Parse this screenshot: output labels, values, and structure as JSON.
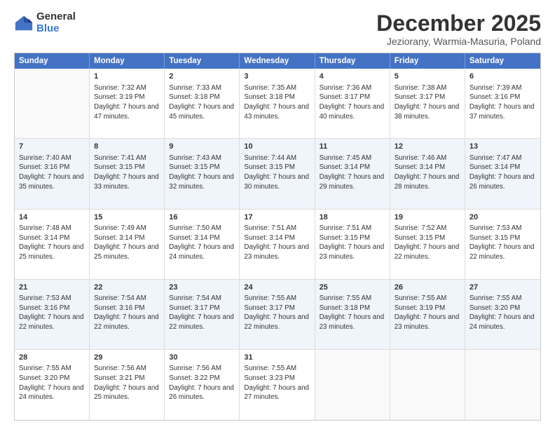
{
  "logo": {
    "general": "General",
    "blue": "Blue"
  },
  "title": "December 2025",
  "subtitle": "Jeziorany, Warmia-Masuria, Poland",
  "weekdays": [
    "Sunday",
    "Monday",
    "Tuesday",
    "Wednesday",
    "Thursday",
    "Friday",
    "Saturday"
  ],
  "rows": [
    [
      {
        "day": "",
        "sunrise": "",
        "sunset": "",
        "daylight": ""
      },
      {
        "day": "1",
        "sunrise": "Sunrise: 7:32 AM",
        "sunset": "Sunset: 3:19 PM",
        "daylight": "Daylight: 7 hours and 47 minutes."
      },
      {
        "day": "2",
        "sunrise": "Sunrise: 7:33 AM",
        "sunset": "Sunset: 3:18 PM",
        "daylight": "Daylight: 7 hours and 45 minutes."
      },
      {
        "day": "3",
        "sunrise": "Sunrise: 7:35 AM",
        "sunset": "Sunset: 3:18 PM",
        "daylight": "Daylight: 7 hours and 43 minutes."
      },
      {
        "day": "4",
        "sunrise": "Sunrise: 7:36 AM",
        "sunset": "Sunset: 3:17 PM",
        "daylight": "Daylight: 7 hours and 40 minutes."
      },
      {
        "day": "5",
        "sunrise": "Sunrise: 7:38 AM",
        "sunset": "Sunset: 3:17 PM",
        "daylight": "Daylight: 7 hours and 38 minutes."
      },
      {
        "day": "6",
        "sunrise": "Sunrise: 7:39 AM",
        "sunset": "Sunset: 3:16 PM",
        "daylight": "Daylight: 7 hours and 37 minutes."
      }
    ],
    [
      {
        "day": "7",
        "sunrise": "Sunrise: 7:40 AM",
        "sunset": "Sunset: 3:16 PM",
        "daylight": "Daylight: 7 hours and 35 minutes."
      },
      {
        "day": "8",
        "sunrise": "Sunrise: 7:41 AM",
        "sunset": "Sunset: 3:15 PM",
        "daylight": "Daylight: 7 hours and 33 minutes."
      },
      {
        "day": "9",
        "sunrise": "Sunrise: 7:43 AM",
        "sunset": "Sunset: 3:15 PM",
        "daylight": "Daylight: 7 hours and 32 minutes."
      },
      {
        "day": "10",
        "sunrise": "Sunrise: 7:44 AM",
        "sunset": "Sunset: 3:15 PM",
        "daylight": "Daylight: 7 hours and 30 minutes."
      },
      {
        "day": "11",
        "sunrise": "Sunrise: 7:45 AM",
        "sunset": "Sunset: 3:14 PM",
        "daylight": "Daylight: 7 hours and 29 minutes."
      },
      {
        "day": "12",
        "sunrise": "Sunrise: 7:46 AM",
        "sunset": "Sunset: 3:14 PM",
        "daylight": "Daylight: 7 hours and 28 minutes."
      },
      {
        "day": "13",
        "sunrise": "Sunrise: 7:47 AM",
        "sunset": "Sunset: 3:14 PM",
        "daylight": "Daylight: 7 hours and 26 minutes."
      }
    ],
    [
      {
        "day": "14",
        "sunrise": "Sunrise: 7:48 AM",
        "sunset": "Sunset: 3:14 PM",
        "daylight": "Daylight: 7 hours and 25 minutes."
      },
      {
        "day": "15",
        "sunrise": "Sunrise: 7:49 AM",
        "sunset": "Sunset: 3:14 PM",
        "daylight": "Daylight: 7 hours and 25 minutes."
      },
      {
        "day": "16",
        "sunrise": "Sunrise: 7:50 AM",
        "sunset": "Sunset: 3:14 PM",
        "daylight": "Daylight: 7 hours and 24 minutes."
      },
      {
        "day": "17",
        "sunrise": "Sunrise: 7:51 AM",
        "sunset": "Sunset: 3:14 PM",
        "daylight": "Daylight: 7 hours and 23 minutes."
      },
      {
        "day": "18",
        "sunrise": "Sunrise: 7:51 AM",
        "sunset": "Sunset: 3:15 PM",
        "daylight": "Daylight: 7 hours and 23 minutes."
      },
      {
        "day": "19",
        "sunrise": "Sunrise: 7:52 AM",
        "sunset": "Sunset: 3:15 PM",
        "daylight": "Daylight: 7 hours and 22 minutes."
      },
      {
        "day": "20",
        "sunrise": "Sunrise: 7:53 AM",
        "sunset": "Sunset: 3:15 PM",
        "daylight": "Daylight: 7 hours and 22 minutes."
      }
    ],
    [
      {
        "day": "21",
        "sunrise": "Sunrise: 7:53 AM",
        "sunset": "Sunset: 3:16 PM",
        "daylight": "Daylight: 7 hours and 22 minutes."
      },
      {
        "day": "22",
        "sunrise": "Sunrise: 7:54 AM",
        "sunset": "Sunset: 3:16 PM",
        "daylight": "Daylight: 7 hours and 22 minutes."
      },
      {
        "day": "23",
        "sunrise": "Sunrise: 7:54 AM",
        "sunset": "Sunset: 3:17 PM",
        "daylight": "Daylight: 7 hours and 22 minutes."
      },
      {
        "day": "24",
        "sunrise": "Sunrise: 7:55 AM",
        "sunset": "Sunset: 3:17 PM",
        "daylight": "Daylight: 7 hours and 22 minutes."
      },
      {
        "day": "25",
        "sunrise": "Sunrise: 7:55 AM",
        "sunset": "Sunset: 3:18 PM",
        "daylight": "Daylight: 7 hours and 23 minutes."
      },
      {
        "day": "26",
        "sunrise": "Sunrise: 7:55 AM",
        "sunset": "Sunset: 3:19 PM",
        "daylight": "Daylight: 7 hours and 23 minutes."
      },
      {
        "day": "27",
        "sunrise": "Sunrise: 7:55 AM",
        "sunset": "Sunset: 3:20 PM",
        "daylight": "Daylight: 7 hours and 24 minutes."
      }
    ],
    [
      {
        "day": "28",
        "sunrise": "Sunrise: 7:55 AM",
        "sunset": "Sunset: 3:20 PM",
        "daylight": "Daylight: 7 hours and 24 minutes."
      },
      {
        "day": "29",
        "sunrise": "Sunrise: 7:56 AM",
        "sunset": "Sunset: 3:21 PM",
        "daylight": "Daylight: 7 hours and 25 minutes."
      },
      {
        "day": "30",
        "sunrise": "Sunrise: 7:56 AM",
        "sunset": "Sunset: 3:22 PM",
        "daylight": "Daylight: 7 hours and 26 minutes."
      },
      {
        "day": "31",
        "sunrise": "Sunrise: 7:55 AM",
        "sunset": "Sunset: 3:23 PM",
        "daylight": "Daylight: 7 hours and 27 minutes."
      },
      {
        "day": "",
        "sunrise": "",
        "sunset": "",
        "daylight": ""
      },
      {
        "day": "",
        "sunrise": "",
        "sunset": "",
        "daylight": ""
      },
      {
        "day": "",
        "sunrise": "",
        "sunset": "",
        "daylight": ""
      }
    ]
  ]
}
